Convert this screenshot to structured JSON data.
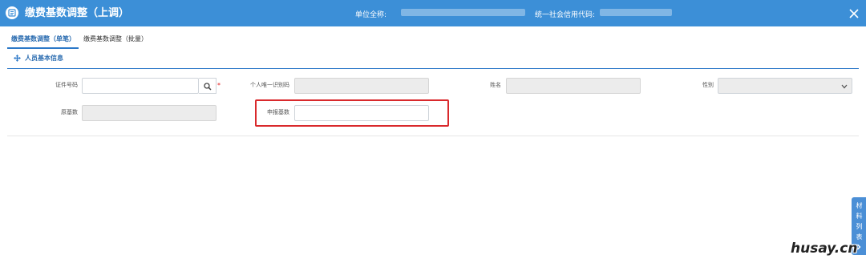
{
  "header": {
    "title": "缴费基数调整（上调）",
    "unit_label": "单位全称:",
    "credit_label": "统一社会信用代码:"
  },
  "tabs": [
    {
      "label": "缴费基数调整（单笔）",
      "active": true
    },
    {
      "label": "缴费基数调整（批量）",
      "active": false
    }
  ],
  "section": {
    "title": "人员基本信息"
  },
  "form": {
    "id_number": {
      "label": "证件号码",
      "value": "",
      "required_mark": "*"
    },
    "personal_id": {
      "label": "个人唯一识别码",
      "value": ""
    },
    "name": {
      "label": "姓名",
      "value": ""
    },
    "gender": {
      "label": "性别",
      "value": ""
    },
    "original_base": {
      "label": "原基数",
      "value": ""
    },
    "declared_base": {
      "label": "申报基数",
      "value": ""
    }
  },
  "side_panel": {
    "label": "材料列表"
  },
  "watermark": "husay.cn",
  "colors": {
    "header_bg": "#3c8fd7",
    "accent": "#2b78c8",
    "highlight": "#d9292c",
    "side_panel": "#4b8fd6"
  }
}
